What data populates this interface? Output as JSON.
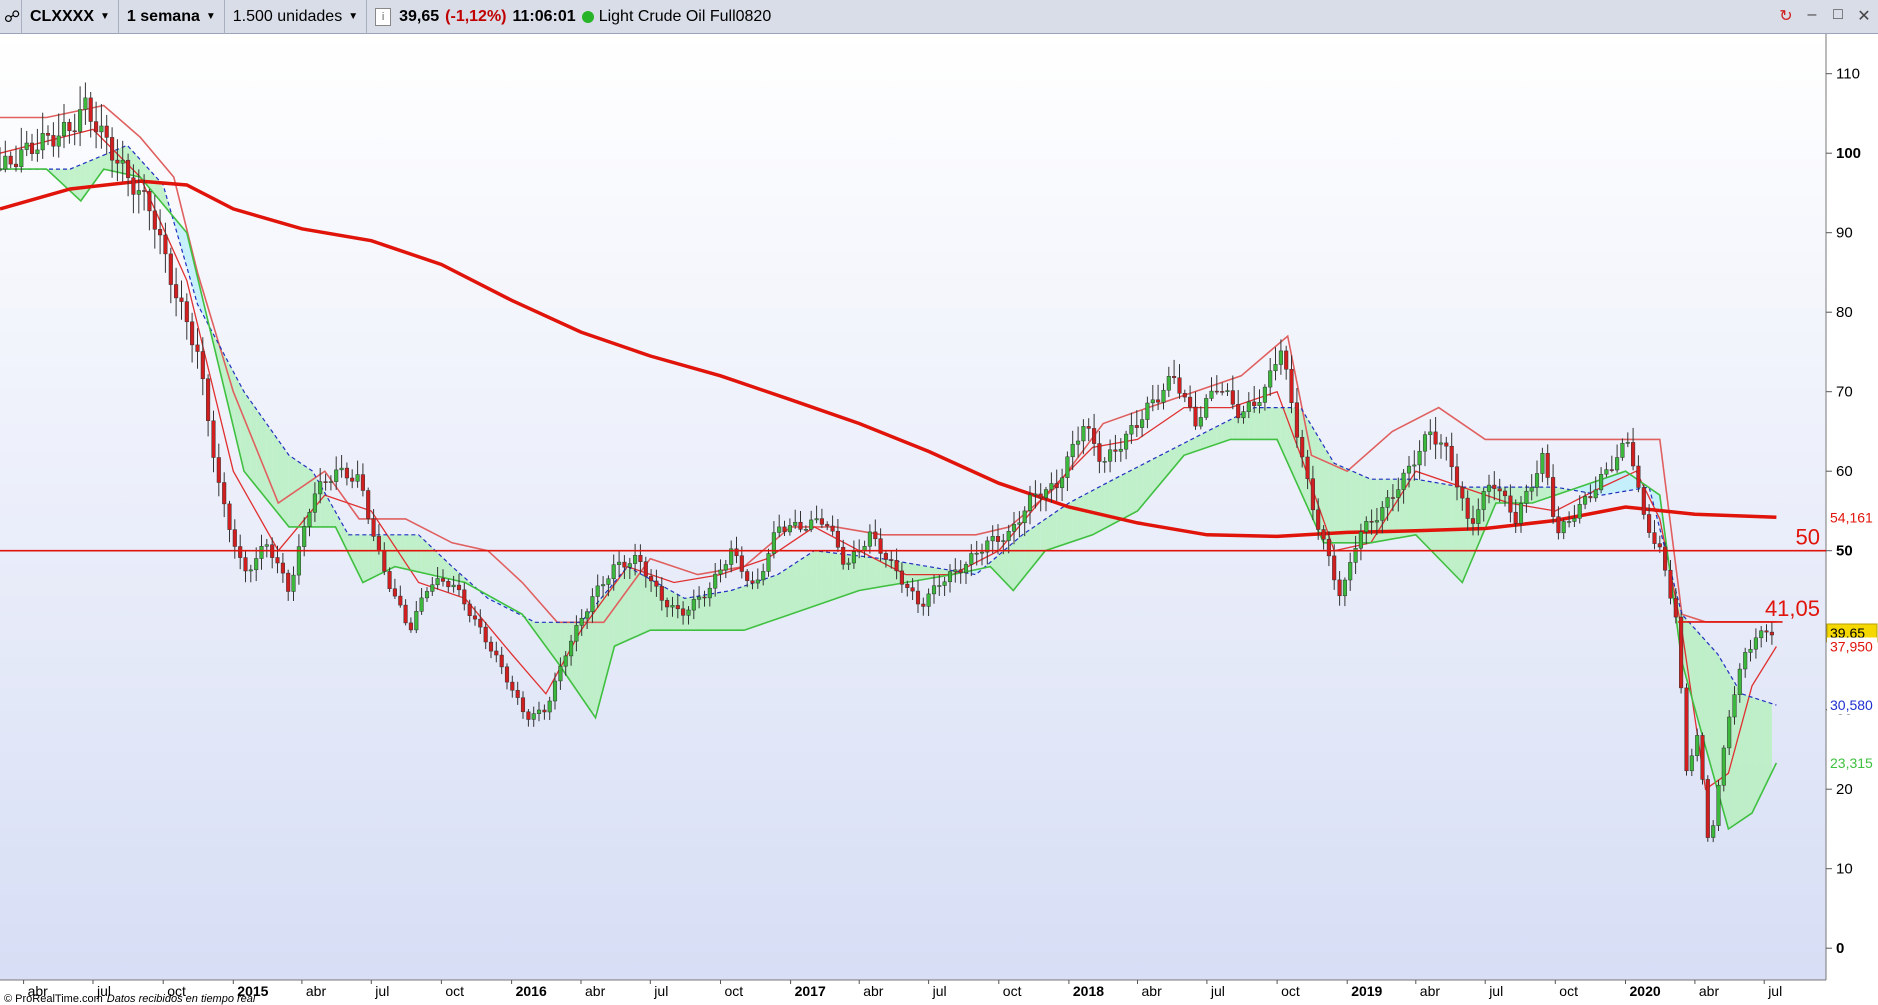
{
  "toolbar": {
    "symbol": "CLXXXX",
    "timeframe": "1 semana",
    "units": "1.500 unidades",
    "last_price": "39,65",
    "change": "(-1,12%)",
    "time": "11:06:01",
    "instrument_name": "Light Crude Oil Full0820",
    "status_color": "#28b428",
    "icons": [
      "chart-sync-icon",
      "minimize-icon",
      "maximize-icon",
      "close-icon"
    ]
  },
  "watermark": {
    "brand": "© ProRealTime.com",
    "note": "Datos recibidos en tiempo real"
  },
  "chart_data": {
    "type": "line",
    "title": "",
    "xlabel": "",
    "ylabel": "",
    "x_range": [
      "2014-03-01",
      "2020-09-20"
    ],
    "ylim": [
      -4,
      115
    ],
    "y_ticks": [
      0,
      10,
      20,
      30,
      40,
      50,
      60,
      70,
      80,
      90,
      100,
      110
    ],
    "x_ticks": [
      {
        "label": "abr",
        "date": "2014-04-01",
        "bold": false
      },
      {
        "label": "jul",
        "date": "2014-07-01",
        "bold": false
      },
      {
        "label": "oct",
        "date": "2014-10-01",
        "bold": false
      },
      {
        "label": "2015",
        "date": "2015-01-01",
        "bold": true
      },
      {
        "label": "abr",
        "date": "2015-04-01",
        "bold": false
      },
      {
        "label": "jul",
        "date": "2015-07-01",
        "bold": false
      },
      {
        "label": "oct",
        "date": "2015-10-01",
        "bold": false
      },
      {
        "label": "2016",
        "date": "2016-01-01",
        "bold": true
      },
      {
        "label": "abr",
        "date": "2016-04-01",
        "bold": false
      },
      {
        "label": "jul",
        "date": "2016-07-01",
        "bold": false
      },
      {
        "label": "oct",
        "date": "2016-10-01",
        "bold": false
      },
      {
        "label": "2017",
        "date": "2017-01-01",
        "bold": true
      },
      {
        "label": "abr",
        "date": "2017-04-01",
        "bold": false
      },
      {
        "label": "jul",
        "date": "2017-07-01",
        "bold": false
      },
      {
        "label": "oct",
        "date": "2017-10-01",
        "bold": false
      },
      {
        "label": "2018",
        "date": "2018-01-01",
        "bold": true
      },
      {
        "label": "abr",
        "date": "2018-04-01",
        "bold": false
      },
      {
        "label": "jul",
        "date": "2018-07-01",
        "bold": false
      },
      {
        "label": "oct",
        "date": "2018-10-01",
        "bold": false
      },
      {
        "label": "2019",
        "date": "2019-01-01",
        "bold": true
      },
      {
        "label": "abr",
        "date": "2019-04-01",
        "bold": false
      },
      {
        "label": "jul",
        "date": "2019-07-01",
        "bold": false
      },
      {
        "label": "oct",
        "date": "2019-10-01",
        "bold": false
      },
      {
        "label": "2020",
        "date": "2020-01-01",
        "bold": true
      },
      {
        "label": "abr",
        "date": "2020-04-01",
        "bold": false
      },
      {
        "label": "jul",
        "date": "2020-07-01",
        "bold": false
      }
    ],
    "price_path": [
      [
        "2014-03-01",
        98
      ],
      [
        "2014-04-15",
        101
      ],
      [
        "2014-06-01",
        103
      ],
      [
        "2014-06-20",
        106
      ],
      [
        "2014-07-15",
        102
      ],
      [
        "2014-08-15",
        97
      ],
      [
        "2014-09-15",
        93
      ],
      [
        "2014-10-15",
        83
      ],
      [
        "2014-11-15",
        75
      ],
      [
        "2014-12-15",
        57
      ],
      [
        "2015-01-15",
        47
      ],
      [
        "2015-02-15",
        51
      ],
      [
        "2015-03-15",
        45
      ],
      [
        "2015-04-15",
        57
      ],
      [
        "2015-05-15",
        60
      ],
      [
        "2015-06-15",
        59
      ],
      [
        "2015-07-15",
        48
      ],
      [
        "2015-08-20",
        40
      ],
      [
        "2015-09-15",
        46
      ],
      [
        "2015-10-15",
        46
      ],
      [
        "2015-11-15",
        41
      ],
      [
        "2015-12-15",
        36
      ],
      [
        "2016-01-20",
        29
      ],
      [
        "2016-02-15",
        30
      ],
      [
        "2016-03-15",
        38
      ],
      [
        "2016-04-15",
        44
      ],
      [
        "2016-05-15",
        48
      ],
      [
        "2016-06-15",
        49
      ],
      [
        "2016-07-15",
        44
      ],
      [
        "2016-08-10",
        42
      ],
      [
        "2016-09-15",
        45
      ],
      [
        "2016-10-15",
        50
      ],
      [
        "2016-11-15",
        45
      ],
      [
        "2016-12-15",
        53
      ],
      [
        "2017-01-15",
        53
      ],
      [
        "2017-02-15",
        54
      ],
      [
        "2017-03-15",
        48
      ],
      [
        "2017-04-15",
        52
      ],
      [
        "2017-05-15",
        48
      ],
      [
        "2017-06-20",
        43
      ],
      [
        "2017-07-15",
        46
      ],
      [
        "2017-08-15",
        48
      ],
      [
        "2017-09-15",
        51
      ],
      [
        "2017-10-15",
        52
      ],
      [
        "2017-11-15",
        57
      ],
      [
        "2017-12-15",
        58
      ],
      [
        "2018-01-20",
        66
      ],
      [
        "2018-02-15",
        61
      ],
      [
        "2018-03-15",
        64
      ],
      [
        "2018-04-15",
        68
      ],
      [
        "2018-05-20",
        72
      ],
      [
        "2018-06-15",
        66
      ],
      [
        "2018-07-15",
        71
      ],
      [
        "2018-08-15",
        67
      ],
      [
        "2018-09-15",
        70
      ],
      [
        "2018-10-05",
        76
      ],
      [
        "2018-10-25",
        66
      ],
      [
        "2018-11-15",
        56
      ],
      [
        "2018-12-24",
        44
      ],
      [
        "2019-01-15",
        52
      ],
      [
        "2019-02-15",
        55
      ],
      [
        "2019-03-15",
        59
      ],
      [
        "2019-04-20",
        65
      ],
      [
        "2019-05-15",
        62
      ],
      [
        "2019-06-10",
        53
      ],
      [
        "2019-07-10",
        59
      ],
      [
        "2019-08-10",
        54
      ],
      [
        "2019-09-16",
        62
      ],
      [
        "2019-10-03",
        52
      ],
      [
        "2019-11-15",
        57
      ],
      [
        "2019-12-15",
        61
      ],
      [
        "2020-01-06",
        64
      ],
      [
        "2020-01-25",
        54
      ],
      [
        "2020-02-15",
        50
      ],
      [
        "2020-03-09",
        41
      ],
      [
        "2020-03-20",
        22
      ],
      [
        "2020-04-05",
        27
      ],
      [
        "2020-04-20",
        12
      ],
      [
        "2020-04-27",
        17
      ],
      [
        "2020-05-15",
        29
      ],
      [
        "2020-06-05",
        37
      ],
      [
        "2020-06-20",
        39
      ],
      [
        "2020-07-05",
        40
      ],
      [
        "2020-07-17",
        39.65
      ]
    ],
    "moving_average": [
      [
        "2014-03-01",
        93
      ],
      [
        "2014-06-01",
        95.5
      ],
      [
        "2014-09-01",
        96.5
      ],
      [
        "2014-11-01",
        96
      ],
      [
        "2015-01-01",
        93
      ],
      [
        "2015-04-01",
        90.5
      ],
      [
        "2015-07-01",
        89
      ],
      [
        "2015-10-01",
        86
      ],
      [
        "2016-01-01",
        81.5
      ],
      [
        "2016-04-01",
        77.5
      ],
      [
        "2016-07-01",
        74.5
      ],
      [
        "2016-10-01",
        72
      ],
      [
        "2017-01-01",
        69
      ],
      [
        "2017-04-01",
        66
      ],
      [
        "2017-07-01",
        62.5
      ],
      [
        "2017-10-01",
        58.5
      ],
      [
        "2018-01-01",
        55.5
      ],
      [
        "2018-04-01",
        53.5
      ],
      [
        "2018-07-01",
        52
      ],
      [
        "2018-10-01",
        51.8
      ],
      [
        "2019-01-01",
        52.3
      ],
      [
        "2019-04-01",
        52.5
      ],
      [
        "2019-07-01",
        52.8
      ],
      [
        "2019-10-01",
        53.8
      ],
      [
        "2020-01-01",
        55.5
      ],
      [
        "2020-04-01",
        54.6
      ],
      [
        "2020-07-17",
        54.2
      ]
    ],
    "tenkan_line": [
      [
        "2014-03-01",
        100
      ],
      [
        "2014-07-01",
        103
      ],
      [
        "2014-09-01",
        97
      ],
      [
        "2014-11-01",
        84
      ],
      [
        "2015-01-01",
        60
      ],
      [
        "2015-03-01",
        50
      ],
      [
        "2015-05-01",
        57
      ],
      [
        "2015-07-01",
        55
      ],
      [
        "2015-09-01",
        46
      ],
      [
        "2015-11-01",
        44
      ],
      [
        "2016-01-01",
        37
      ],
      [
        "2016-02-15",
        32
      ],
      [
        "2016-04-01",
        40
      ],
      [
        "2016-06-01",
        48
      ],
      [
        "2016-08-01",
        46
      ],
      [
        "2016-10-01",
        47
      ],
      [
        "2016-12-01",
        49
      ],
      [
        "2017-02-01",
        53
      ],
      [
        "2017-04-01",
        50
      ],
      [
        "2017-06-01",
        47
      ],
      [
        "2017-08-01",
        47
      ],
      [
        "2017-10-01",
        50
      ],
      [
        "2017-12-01",
        57
      ],
      [
        "2018-02-01",
        63
      ],
      [
        "2018-04-01",
        64
      ],
      [
        "2018-06-01",
        68
      ],
      [
        "2018-08-01",
        68
      ],
      [
        "2018-10-01",
        70
      ],
      [
        "2018-11-01",
        62
      ],
      [
        "2018-12-15",
        50
      ],
      [
        "2019-02-01",
        51
      ],
      [
        "2019-04-01",
        60
      ],
      [
        "2019-06-01",
        58
      ],
      [
        "2019-08-01",
        56
      ],
      [
        "2019-10-01",
        55
      ],
      [
        "2019-12-01",
        58
      ],
      [
        "2020-01-15",
        60
      ],
      [
        "2020-02-15",
        54
      ],
      [
        "2020-03-15",
        40
      ],
      [
        "2020-04-15",
        20
      ],
      [
        "2020-05-15",
        22
      ],
      [
        "2020-06-15",
        33
      ],
      [
        "2020-07-17",
        37.95
      ]
    ],
    "kijun_line": [
      [
        "2014-03-01",
        98
      ],
      [
        "2014-06-01",
        98
      ],
      [
        "2014-08-15",
        101
      ],
      [
        "2014-10-01",
        96
      ],
      [
        "2014-11-15",
        81
      ],
      [
        "2015-01-15",
        70
      ],
      [
        "2015-03-15",
        62
      ],
      [
        "2015-04-15",
        60
      ],
      [
        "2015-06-01",
        52
      ],
      [
        "2015-09-01",
        52
      ],
      [
        "2015-10-15",
        48
      ],
      [
        "2015-12-01",
        44
      ],
      [
        "2016-02-01",
        41
      ],
      [
        "2016-04-01",
        41
      ],
      [
        "2016-06-01",
        48
      ],
      [
        "2016-08-15",
        44
      ],
      [
        "2016-10-15",
        45
      ],
      [
        "2016-12-15",
        47
      ],
      [
        "2017-02-01",
        50
      ],
      [
        "2017-05-01",
        49
      ],
      [
        "2017-07-01",
        48
      ],
      [
        "2017-09-01",
        47
      ],
      [
        "2017-11-01",
        52
      ],
      [
        "2018-01-01",
        56
      ],
      [
        "2018-03-01",
        59
      ],
      [
        "2018-05-01",
        62
      ],
      [
        "2018-07-01",
        65
      ],
      [
        "2018-09-01",
        68
      ],
      [
        "2018-11-01",
        68
      ],
      [
        "2018-12-15",
        61
      ],
      [
        "2019-02-01",
        59
      ],
      [
        "2019-04-01",
        59
      ],
      [
        "2019-06-01",
        58
      ],
      [
        "2019-08-01",
        58
      ],
      [
        "2019-10-01",
        58
      ],
      [
        "2019-12-01",
        57
      ],
      [
        "2020-02-01",
        58
      ],
      [
        "2020-03-15",
        42
      ],
      [
        "2020-05-01",
        37
      ],
      [
        "2020-06-01",
        32
      ],
      [
        "2020-07-17",
        30.58
      ]
    ],
    "chikou_line": [
      [
        "2014-03-01",
        104.5
      ],
      [
        "2014-05-01",
        104.5
      ],
      [
        "2014-07-15",
        106
      ],
      [
        "2014-09-01",
        102
      ],
      [
        "2014-10-15",
        97
      ],
      [
        "2014-11-15",
        85
      ],
      [
        "2015-01-01",
        70
      ],
      [
        "2015-03-01",
        56
      ],
      [
        "2015-05-01",
        60
      ],
      [
        "2015-06-15",
        54
      ],
      [
        "2015-08-15",
        54
      ],
      [
        "2015-10-15",
        51
      ],
      [
        "2015-12-01",
        50
      ],
      [
        "2016-01-15",
        46
      ],
      [
        "2016-03-01",
        41
      ],
      [
        "2016-05-01",
        41
      ],
      [
        "2016-07-01",
        49
      ],
      [
        "2016-09-01",
        47
      ],
      [
        "2016-11-01",
        48
      ],
      [
        "2017-01-01",
        53
      ],
      [
        "2017-03-01",
        53
      ],
      [
        "2017-05-01",
        52
      ],
      [
        "2017-07-01",
        52
      ],
      [
        "2017-09-01",
        52
      ],
      [
        "2017-10-15",
        53
      ],
      [
        "2017-12-15",
        58
      ],
      [
        "2018-02-15",
        66
      ],
      [
        "2018-04-15",
        68
      ],
      [
        "2018-06-15",
        70
      ],
      [
        "2018-08-15",
        72
      ],
      [
        "2018-10-15",
        77
      ],
      [
        "2018-11-15",
        62
      ],
      [
        "2019-01-01",
        60
      ],
      [
        "2019-03-01",
        65
      ],
      [
        "2019-05-01",
        68
      ],
      [
        "2019-07-01",
        64
      ],
      [
        "2019-09-01",
        64
      ],
      [
        "2019-11-01",
        64
      ],
      [
        "2020-01-01",
        64
      ],
      [
        "2020-02-15",
        64
      ],
      [
        "2020-03-15",
        42
      ],
      [
        "2020-04-15",
        41.05
      ],
      [
        "2020-07-17",
        41.05
      ]
    ],
    "senkou_line": [
      [
        "2014-03-01",
        98
      ],
      [
        "2014-05-01",
        98
      ],
      [
        "2014-06-15",
        94
      ],
      [
        "2014-07-15",
        98
      ],
      [
        "2014-09-01",
        97
      ],
      [
        "2014-11-01",
        90
      ],
      [
        "2015-01-15",
        60
      ],
      [
        "2015-03-15",
        53
      ],
      [
        "2015-05-15",
        53
      ],
      [
        "2015-06-20",
        46
      ],
      [
        "2015-08-01",
        48
      ],
      [
        "2015-11-01",
        46
      ],
      [
        "2016-01-15",
        42
      ],
      [
        "2016-03-01",
        36
      ],
      [
        "2016-04-20",
        29
      ],
      [
        "2016-05-15",
        38
      ],
      [
        "2016-07-01",
        40
      ],
      [
        "2016-09-01",
        40
      ],
      [
        "2016-11-01",
        40
      ],
      [
        "2017-01-01",
        42
      ],
      [
        "2017-04-01",
        45
      ],
      [
        "2017-06-01",
        46
      ],
      [
        "2017-08-01",
        47
      ],
      [
        "2017-09-20",
        48
      ],
      [
        "2017-10-20",
        45
      ],
      [
        "2017-12-01",
        50
      ],
      [
        "2018-02-01",
        52
      ],
      [
        "2018-04-01",
        55
      ],
      [
        "2018-06-01",
        62
      ],
      [
        "2018-08-01",
        64
      ],
      [
        "2018-10-01",
        64
      ],
      [
        "2018-12-01",
        51
      ],
      [
        "2019-02-01",
        51
      ],
      [
        "2019-04-01",
        52
      ],
      [
        "2019-06-01",
        46
      ],
      [
        "2019-07-15",
        56
      ],
      [
        "2019-09-01",
        56
      ],
      [
        "2019-11-01",
        58
      ],
      [
        "2020-01-01",
        60
      ],
      [
        "2020-02-15",
        57
      ],
      [
        "2020-03-15",
        36
      ],
      [
        "2020-05-15",
        15
      ],
      [
        "2020-06-15",
        17
      ],
      [
        "2020-07-17",
        23.315
      ]
    ],
    "horizontal_levels": [
      {
        "value": 50,
        "label": "50"
      },
      {
        "value": 41.05,
        "label": "41,05"
      }
    ],
    "price_labels": [
      {
        "value": 54.161,
        "text": "54,161",
        "color": "#e0140a"
      },
      {
        "value": 39.65,
        "text": "39,65",
        "color": "#000000"
      },
      {
        "value": 37.95,
        "text": "37,950",
        "color": "#e0140a"
      },
      {
        "value": 30.58,
        "text": "30,580",
        "color": "#1f2fd0"
      },
      {
        "value": 23.315,
        "text": "23,315",
        "color": "#40c040"
      }
    ],
    "colors": {
      "up_candle": "#3cb83c",
      "down_candle": "#d21e1e",
      "moving_average": "#e0140a",
      "tenkan": "#e03030",
      "kijun": "#2030c0",
      "chikou": "#e06060",
      "senkou": "#40c040",
      "cloud_bull": "#b7f0c0",
      "cloud_bear": "#bdeefa",
      "last_price_badge": "#f5d800"
    },
    "grid": false
  }
}
